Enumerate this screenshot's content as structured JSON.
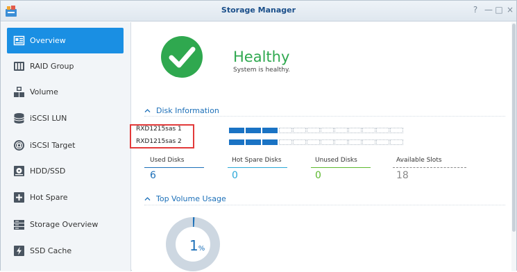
{
  "window": {
    "title": "Storage Manager",
    "controls": [
      {
        "name": "help-button",
        "glyph": "?"
      },
      {
        "name": "minimize-button",
        "glyph": "—"
      },
      {
        "name": "maximize-button",
        "glyph": "□"
      },
      {
        "name": "close-button",
        "glyph": "×"
      }
    ]
  },
  "sidebar": {
    "active_index": 0,
    "items": [
      {
        "label": "Overview",
        "icon": "overview-icon"
      },
      {
        "label": "RAID Group",
        "icon": "raid-group-icon"
      },
      {
        "label": "Volume",
        "icon": "volume-icon"
      },
      {
        "label": "iSCSI LUN",
        "icon": "iscsi-lun-icon"
      },
      {
        "label": "iSCSI Target",
        "icon": "iscsi-target-icon"
      },
      {
        "label": "HDD/SSD",
        "icon": "hdd-ssd-icon"
      },
      {
        "label": "Hot Spare",
        "icon": "hot-spare-icon"
      },
      {
        "label": "Storage Overview",
        "icon": "storage-overview-icon"
      },
      {
        "label": "SSD Cache",
        "icon": "ssd-cache-icon"
      }
    ]
  },
  "health": {
    "status": "Healthy",
    "message": "System is healthy.",
    "icon": "checkmark-icon",
    "color": "#2fa84f"
  },
  "disk_information": {
    "title": "Disk Information",
    "enclosures": [
      {
        "name": "RXD1215sas 1",
        "used_slots": 3,
        "total_slots": 12
      },
      {
        "name": "RXD1215sas 2",
        "used_slots": 3,
        "total_slots": 12
      }
    ],
    "stats": [
      {
        "label": "Used Disks",
        "value": "6",
        "color": "#1b6fb8"
      },
      {
        "label": "Hot Spare Disks",
        "value": "0",
        "color": "#2aa8d8"
      },
      {
        "label": "Unused Disks",
        "value": "0",
        "color": "#5cb82e"
      },
      {
        "label": "Available Slots",
        "value": "18",
        "color": "#8a8a8a"
      }
    ]
  },
  "top_volume_usage": {
    "title": "Top Volume Usage",
    "value": "1",
    "unit": "%",
    "usage_fraction": 0.01
  },
  "colors": {
    "accent": "#1a8fe3",
    "slot_filled": "#1a73c4",
    "highlight": "#e23a3a"
  }
}
